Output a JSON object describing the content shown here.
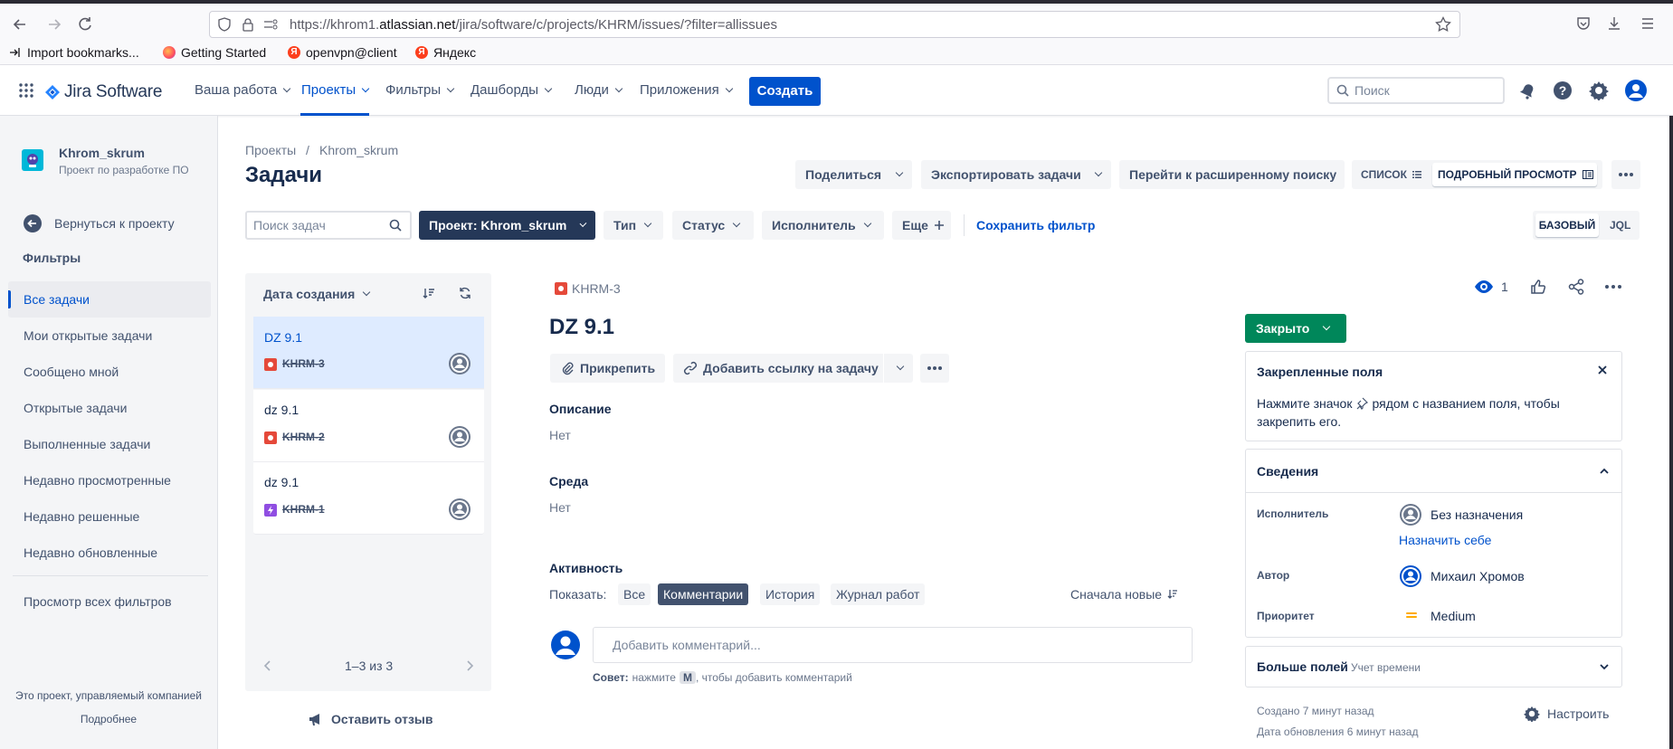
{
  "browser": {
    "url_prefix": "https://khrom1.",
    "url_domain": "atlassian.net",
    "url_rest": "/jira/software/c/projects/KHRM/issues/?filter=allissues",
    "bookmarks": [
      "Import bookmarks...",
      "Getting Started",
      "openvpn@client",
      "Яндекс"
    ]
  },
  "topnav": {
    "product": "Jira Software",
    "items": [
      "Ваша работа",
      "Проекты",
      "Фильтры",
      "Дашборды",
      "Люди",
      "Приложения"
    ],
    "create": "Создать",
    "search_placeholder": "Поиск"
  },
  "sidebar": {
    "project_name": "Khrom_skrum",
    "project_type": "Проект по разработке ПО",
    "back": "Вернуться к проекту",
    "section": "Фильтры",
    "filters": [
      "Все задачи",
      "Мои открытые задачи",
      "Сообщено мной",
      "Открытые задачи",
      "Выполненные задачи",
      "Недавно просмотренные",
      "Недавно решенные",
      "Недавно обновленные"
    ],
    "all_filters": "Просмотр всех фильтров",
    "footer1": "Это проект, управляемый компанией",
    "footer2": "Подробнее"
  },
  "header": {
    "breadcrumb_root": "Проекты",
    "breadcrumb_sep": "/",
    "breadcrumb_project": "Khrom_skrum",
    "title": "Задачи",
    "share": "Поделиться",
    "export": "Экспортировать задачи",
    "advanced": "Перейти к расширенному поиску",
    "view_list": "СПИСОК",
    "view_detail": "ПОДРОБНЫЙ ПРОСМОТР"
  },
  "filterbar": {
    "search_placeholder": "Поиск задач",
    "project": "Проект: Khrom_skrum",
    "type": "Тип",
    "status": "Статус",
    "assignee": "Исполнитель",
    "more": "Еще",
    "save": "Сохранить фильтр",
    "basic": "БАЗОВЫЙ",
    "jql": "JQL"
  },
  "issue_list": {
    "sort_label": "Дата создания",
    "items": [
      {
        "summary": "DZ 9.1",
        "key": "KHRM-3",
        "type": "bug"
      },
      {
        "summary": "dz 9.1",
        "key": "KHRM-2",
        "type": "bug"
      },
      {
        "summary": "dz 9.1",
        "key": "KHRM-1",
        "type": "epic"
      }
    ],
    "pagination": "1–3 из 3",
    "feedback": "Оставить отзыв"
  },
  "issue": {
    "key": "KHRM-3",
    "title": "DZ 9.1",
    "watchers": "1",
    "attach": "Прикрепить",
    "link": "Добавить ссылку на задачу",
    "description_label": "Описание",
    "description_value": "Нет",
    "env_label": "Среда",
    "env_value": "Нет",
    "activity_label": "Активность",
    "show_label": "Показать:",
    "activity_tabs": [
      "Все",
      "Комментарии",
      "История",
      "Журнал работ"
    ],
    "sort_newest": "Сначала новые",
    "comment_placeholder": "Добавить комментарий...",
    "tip_bold": "Совет:",
    "tip_text1": "нажмите",
    "tip_key": "M",
    "tip_text2": ", чтобы добавить комментарий"
  },
  "details": {
    "status": "Закрыто",
    "pinned_title": "Закрепленные поля",
    "pinned_text1": "Нажмите значок",
    "pinned_text2": "рядом с названием поля, чтобы",
    "pinned_text3": "закрепить его.",
    "section_title": "Сведения",
    "assignee_label": "Исполнитель",
    "assignee_value": "Без назначения",
    "assign_me": "Назначить себе",
    "reporter_label": "Автор",
    "reporter_value": "Михаил Хромов",
    "priority_label": "Приоритет",
    "priority_value": "Medium",
    "more_fields": "Больше полей",
    "more_fields_sub": "Учет времени",
    "created": "Создано 7 минут назад",
    "updated": "Дата обновления 6 минут назад",
    "configure": "Настроить"
  },
  "colors": {
    "brand": "#0052cc",
    "selected_card": "#deebff",
    "done_green": "#00875a",
    "bug_red": "#e5493a",
    "epic_purple": "#904ee2"
  }
}
